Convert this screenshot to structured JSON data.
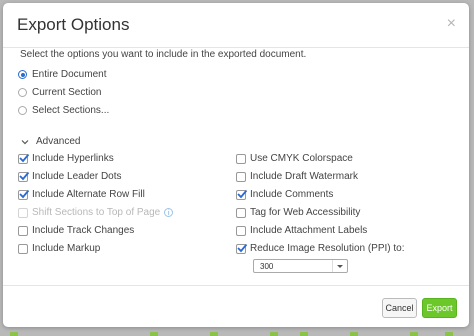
{
  "dialog": {
    "title": "Export Options",
    "close_symbol": "×",
    "instructions": "Select the options you want to include in the exported document.",
    "scope_options": [
      {
        "label": "Entire Document",
        "selected": true
      },
      {
        "label": "Current Section",
        "selected": false
      },
      {
        "label": "Select Sections...",
        "selected": false
      }
    ],
    "advanced_label": "Advanced",
    "left_options": [
      {
        "label": "Include Hyperlinks",
        "checked": true,
        "disabled": false
      },
      {
        "label": "Include Leader Dots",
        "checked": true,
        "disabled": false
      },
      {
        "label": "Include Alternate Row Fill",
        "checked": true,
        "disabled": false
      },
      {
        "label": "Shift Sections to Top of Page",
        "checked": false,
        "disabled": true,
        "info_icon": "info-icon"
      },
      {
        "label": "Include Track Changes",
        "checked": false,
        "disabled": false
      },
      {
        "label": "Include Markup",
        "checked": false,
        "disabled": false
      }
    ],
    "right_options": [
      {
        "label": "Use CMYK Colorspace",
        "checked": false,
        "disabled": false
      },
      {
        "label": "Include Draft Watermark",
        "checked": false,
        "disabled": false
      },
      {
        "label": "Include Comments",
        "checked": true,
        "disabled": false
      },
      {
        "label": "Tag for Web Accessibility",
        "checked": false,
        "disabled": false
      },
      {
        "label": "Include Attachment Labels",
        "checked": false,
        "disabled": false
      },
      {
        "label": "Reduce Image Resolution (PPI) to:",
        "checked": true,
        "disabled": false
      }
    ],
    "ppi_value": "300",
    "cancel_label": "Cancel",
    "export_label": "Export",
    "colors": {
      "accent_blue": "#2a6ad2",
      "export_green": "#6cc72b"
    }
  }
}
